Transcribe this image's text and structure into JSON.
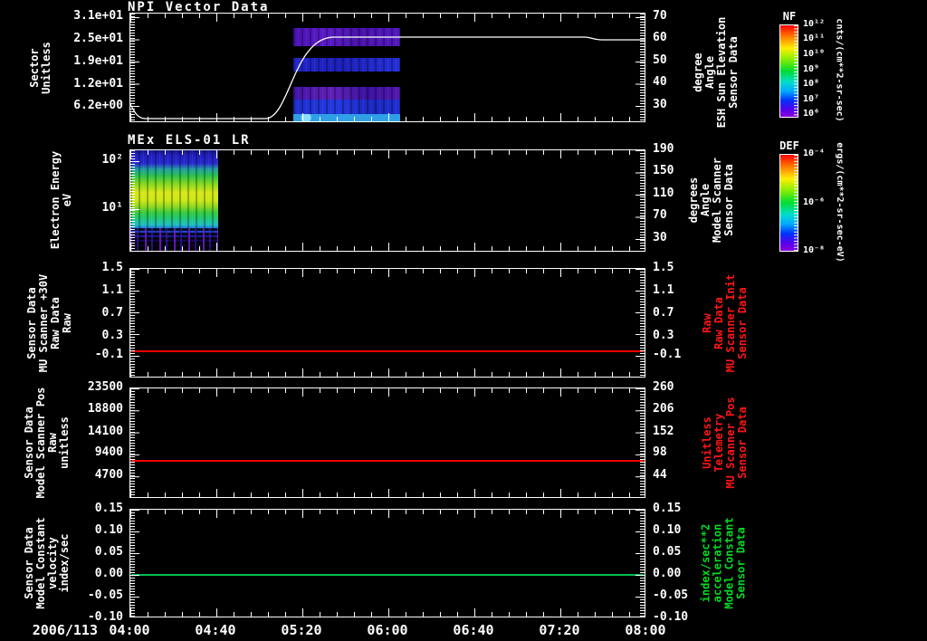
{
  "x_axis": {
    "date_label": "2006/113",
    "tick_labels": [
      "04:00",
      "04:40",
      "05:20",
      "06:00",
      "06:40",
      "07:20",
      "08:00"
    ]
  },
  "panels": [
    {
      "title": "NPI Vector Data",
      "left": {
        "label_lines": [
          "Sector",
          "Unitless"
        ],
        "ticks": [
          "3.1e+01",
          "2.5e+01",
          "1.9e+01",
          "1.2e+01",
          "6.2e+00"
        ]
      },
      "right": {
        "label_lines": [
          "Sensor Data",
          "ESH Sun Elevation",
          "Angle",
          "degree"
        ],
        "ticks": [
          "70",
          "60",
          "50",
          "40",
          "30"
        ],
        "color": "#ffffff"
      }
    },
    {
      "title": "MEx ELS-01 LR",
      "left": {
        "label_lines": [
          "Electron Energy",
          "eV"
        ],
        "ticks": [
          "10²",
          "10¹"
        ]
      },
      "right": {
        "label_lines": [
          "Sensor Data",
          "Model Scanner",
          "Angle",
          "degrees"
        ],
        "ticks": [
          "190",
          "150",
          "110",
          "70",
          "30"
        ],
        "color": "#ffffff"
      }
    },
    {
      "left": {
        "label_lines": [
          "Sensor Data",
          "MU Scanner +30V",
          "Raw Data",
          "Raw"
        ],
        "ticks": [
          "1.5",
          "1.1",
          "0.7",
          "0.3",
          "-0.1"
        ]
      },
      "right": {
        "label_lines": [
          "Sensor Data",
          "MU Scanner Init",
          "Raw Data",
          "Raw"
        ],
        "ticks": [
          "1.5",
          "1.1",
          "0.7",
          "0.3",
          "-0.1"
        ],
        "color": "#ff1515"
      }
    },
    {
      "left": {
        "label_lines": [
          "Sensor Data",
          "Model Scanner Pos",
          "Raw",
          "unitless"
        ],
        "ticks": [
          "23500",
          "18800",
          "14100",
          "9400",
          "4700"
        ]
      },
      "right": {
        "label_lines": [
          "Sensor Data",
          "MU Scanner Pos",
          "Telemetry",
          "Unitless"
        ],
        "ticks": [
          "260",
          "206",
          "152",
          "98",
          "44"
        ],
        "color": "#ff1515"
      }
    },
    {
      "left": {
        "label_lines": [
          "Sensor Data",
          "Model Constant",
          "velocity",
          "index/sec"
        ],
        "ticks": [
          "0.15",
          "0.10",
          "0.05",
          "0.00",
          "-0.05",
          "-0.10"
        ]
      },
      "right": {
        "label_lines": [
          "Sensor Data",
          "Model Constant",
          "acceleration",
          "index/sec**2"
        ],
        "ticks": [
          "0.15",
          "0.10",
          "0.05",
          "0.00",
          "-0.05",
          "-0.10"
        ],
        "color": "#00dd22"
      }
    }
  ],
  "colorbars": [
    {
      "name": "NF",
      "ticks": [
        "10¹²",
        "10¹¹",
        "10¹⁰",
        "10⁹",
        "10⁸",
        "10⁷",
        "10⁶"
      ],
      "unit": "cnts/(cm**2-sr-sec)"
    },
    {
      "name": "DEF",
      "ticks": [
        "10⁻⁴",
        "10⁻⁶",
        "10⁻⁸"
      ],
      "unit": "ergs/(cm**2-sr-sec-eV)"
    }
  ],
  "chart_data": [
    {
      "type": "heatmap",
      "title": "NPI Vector Data",
      "x_range": [
        "2006/113 04:00",
        "2006/113 08:00"
      ],
      "ylabel_left": "Sector Unitless",
      "yticks_left": [
        31,
        24.8,
        18.6,
        12.4,
        6.2
      ],
      "ylabel_right": "Sensor Data ESH Sun Elevation Angle (degree)",
      "yticks_right": [
        70,
        60,
        50,
        40,
        30
      ],
      "colorbar": "NF cnts/(cm**2-sr-sec), 1e6 to 1e12, rainbow",
      "heatmap_time_extent": [
        "05:16",
        "06:05"
      ],
      "heatmap_bands_desc": "four low-intensity violet/blue sector bands plus bright cyan bottom strip between 05:16 and 06:05; rest of panel empty",
      "line_overlay": {
        "name": "ESH Sun Elevation Angle",
        "color": "#ffffff",
        "points": [
          [
            "04:00",
            31
          ],
          [
            "04:07",
            23.2
          ],
          [
            "05:02",
            23.2
          ],
          [
            "05:27",
            60.8
          ],
          [
            "07:31",
            60.8
          ],
          [
            "07:39",
            59.5
          ],
          [
            "08:00",
            59.5
          ]
        ]
      }
    },
    {
      "type": "heatmap",
      "title": "MEx ELS-01 LR",
      "x_range": [
        "2006/113 04:00",
        "2006/113 08:00"
      ],
      "ylabel_left": "Electron Energy (eV)",
      "yscale": "log",
      "yticks_left": [
        100,
        10
      ],
      "y_range_ev": [
        1.3,
        180
      ],
      "ylabel_right": "Sensor Data Model Scanner Angle (degrees)",
      "yticks_right": [
        190,
        150,
        110,
        70,
        30
      ],
      "colorbar": "DEF ergs/(cm**2-sr-sec-eV), 1e-8 to 1e-4, rainbow",
      "heatmap_time_extent": [
        "04:00",
        "04:41"
      ],
      "heatmap_desc": "broad electron spectrum: peak (yellow-green, ~1e-5) near 10-30 eV, green-cyan wings, blue noise above 50 eV, sparse violet noise below 3 eV; no data after 04:41"
    },
    {
      "type": "line",
      "ylabel_left": "Sensor Data MU Scanner +30V Raw Data Raw",
      "yticks": [
        1.5,
        1.1,
        0.7,
        0.3,
        -0.1
      ],
      "ylabel_right": "Sensor Data MU Scanner Init Raw Data Raw",
      "series": [
        {
          "name": "MU Scanner +30V",
          "color": "#ff1515",
          "value_constant": 0.0
        }
      ]
    },
    {
      "type": "line",
      "ylabel_left": "Sensor Data Model Scanner Pos Raw unitless",
      "yticks_left": [
        23500,
        18800,
        14100,
        9400,
        4700
      ],
      "ylabel_right": "Sensor Data MU Scanner Pos Telemetry Unitless",
      "yticks_right": [
        260,
        206,
        152,
        98,
        44
      ],
      "series": [
        {
          "name": "Model Scanner Pos",
          "color": "#ff1515",
          "value_constant_left_scale": 8000,
          "value_constant_right_scale": 83
        }
      ]
    },
    {
      "type": "line",
      "ylabel_left": "Sensor Data Model Constant velocity index/sec",
      "yticks": [
        0.15,
        0.1,
        0.05,
        0.0,
        -0.05,
        -0.1
      ],
      "ylabel_right": "Sensor Data Model Constant acceleration index/sec**2",
      "series": [
        {
          "name": "Model Constant velocity",
          "color": "#00c050",
          "value_constant": 0.0
        }
      ]
    }
  ]
}
